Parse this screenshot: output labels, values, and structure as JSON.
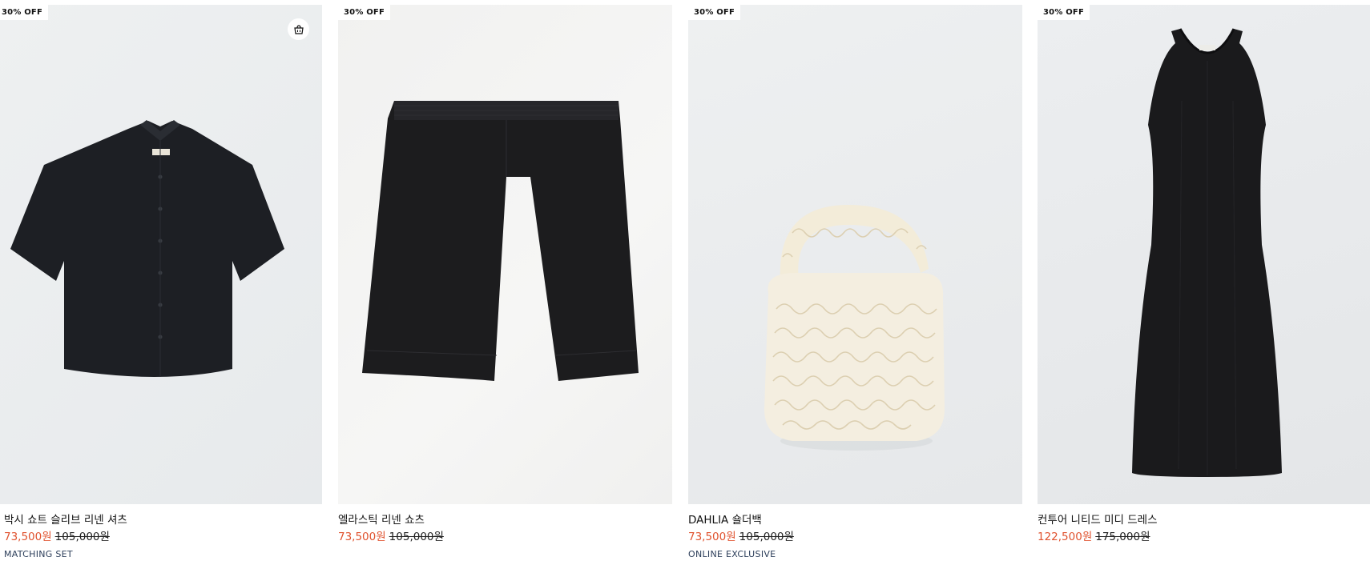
{
  "products": [
    {
      "badge": "30% OFF",
      "name": "박시 쇼트 슬리브 리넨 셔츠",
      "sale_price": "73,500원",
      "original_price": "105,000원",
      "tag": "MATCHING SET",
      "image_icon": "shirt-image"
    },
    {
      "badge": "30% OFF",
      "name": "엘라스틱 리넨 쇼츠",
      "sale_price": "73,500원",
      "original_price": "105,000원",
      "tag": "",
      "image_icon": "shorts-image"
    },
    {
      "badge": "30% OFF",
      "name": "DAHLIA 숄더백",
      "sale_price": "73,500원",
      "original_price": "105,000원",
      "tag": "ONLINE EXCLUSIVE",
      "image_icon": "bag-image"
    },
    {
      "badge": "30% OFF",
      "name": "컨투어 니티드 미디 드레스",
      "sale_price": "122,500원",
      "original_price": "175,000원",
      "tag": "",
      "image_icon": "dress-image"
    }
  ],
  "quick_add_icon": "shopping-bag-icon",
  "colors": {
    "sale": "#e0522e",
    "tag": "#2c3e5a",
    "image_bg": "#eceeef"
  }
}
